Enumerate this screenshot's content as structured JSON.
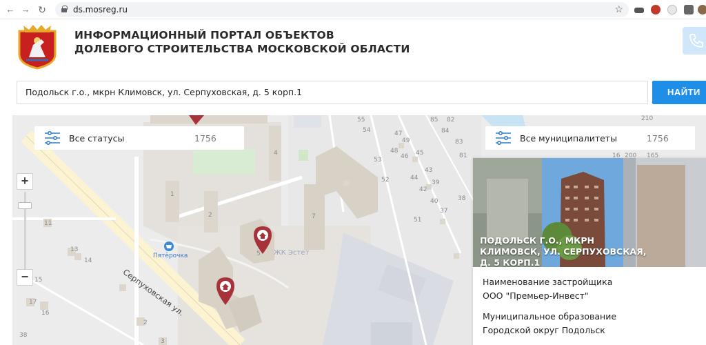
{
  "browser": {
    "url": "ds.mosreg.ru"
  },
  "header": {
    "title_line1": "ИНФОРМАЦИОННЫЙ ПОРТАЛ ОБЪЕКТОВ",
    "title_line2": "ДОЛЕВОГО СТРОИТЕЛЬСТВА МОСКОВСКОЙ ОБЛАСТИ"
  },
  "search": {
    "value": "Подольск г.о., мкрн Климовск, ул. Серпуховская, д. 5 корп.1",
    "button_label": "НАЙТИ"
  },
  "map": {
    "status_filter": {
      "label": "Все статусы",
      "count": "1756"
    },
    "municipality_filter": {
      "label": "Все муниципалитеты",
      "count": "1756"
    },
    "zoom_in": "+",
    "zoom_out": "−",
    "street_label": "Серпуховская ул.",
    "poi_label": "Пятёрочка",
    "complex_label": "ЖК Эстет",
    "building_numbers": {
      "b1": "1",
      "b2": "2",
      "b3": "3",
      "b4": "4",
      "b5": "5",
      "b7": "7",
      "b11": "11",
      "b13": "13",
      "b14": "14",
      "b15": "15",
      "b16": "16",
      "b17": "17",
      "b38": "38",
      "b55a": "55",
      "b54": "54",
      "b47": "47",
      "b49": "49",
      "b48": "48",
      "b46": "46",
      "b45": "45",
      "b53": "53",
      "b52": "52",
      "b44": "44",
      "b43": "43",
      "b39": "39",
      "b42": "42",
      "b40": "40",
      "b38b": "38",
      "b37": "37",
      "b51": "51",
      "b85": "85",
      "b82": "82",
      "b83": "83",
      "b81": "81",
      "b84": "84",
      "b200": "200",
      "b165": "165",
      "b210": "210",
      "b16b": "16",
      "b2b": "2"
    }
  },
  "card": {
    "caption": "ПОДОЛЬСК Г.О., МКРН КЛИМОВСК, УЛ. СЕРПУХОВСКАЯ, Д. 5 КОРП.1",
    "developer_label": "Наименование застройщика",
    "developer_value": "ООО \"Премьер-Инвест\"",
    "municipality_label": "Муниципальное образование",
    "municipality_value": "Городской округ Подольск"
  },
  "colors": {
    "accent": "#1e8ee6",
    "pin": "#a8323a",
    "map_bg": "#ececec",
    "building": "#dcd6cc"
  }
}
